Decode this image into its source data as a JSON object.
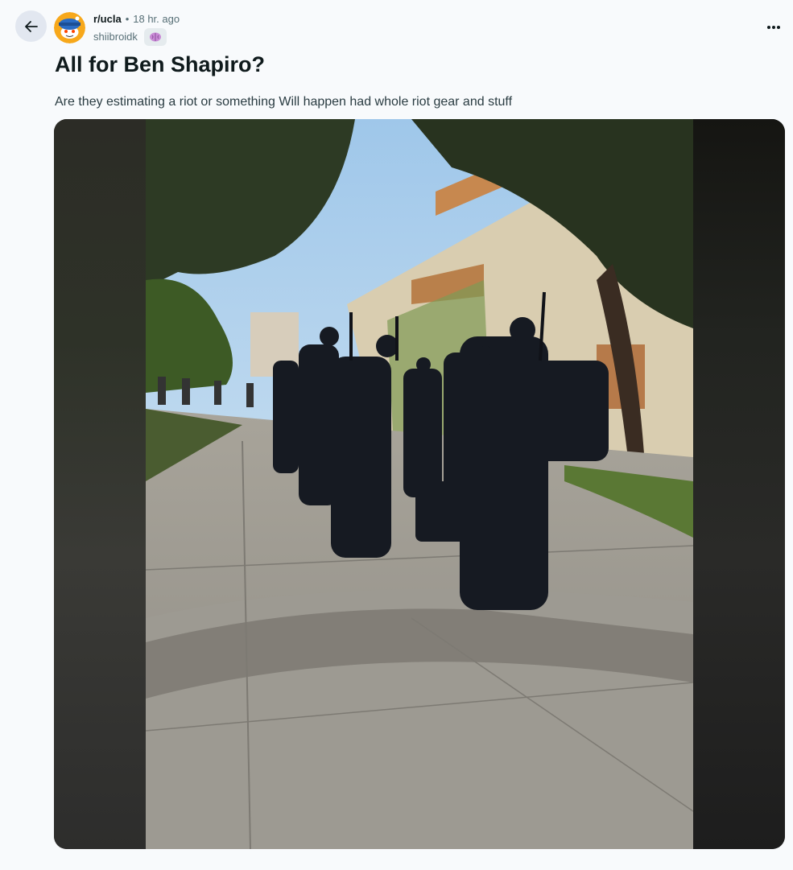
{
  "post": {
    "subreddit": "r/ucla",
    "separator": "•",
    "time_ago": "18 hr. ago",
    "author": "shiibroidk",
    "flair_icon": "brain-icon",
    "title": "All for Ben Shapiro?",
    "body": "Are they estimating a riot or something Will happen had whole riot gear and stuff",
    "image_alt_icon": "photo-officers-walking"
  },
  "icons": {
    "back": "arrow-left-icon",
    "more": "more-horizontal-icon"
  },
  "colors": {
    "background": "#f8fafc",
    "back_button": "#e2e7f0",
    "secondary_text": "#576f76",
    "snoo_orange": "#f7a81b"
  }
}
